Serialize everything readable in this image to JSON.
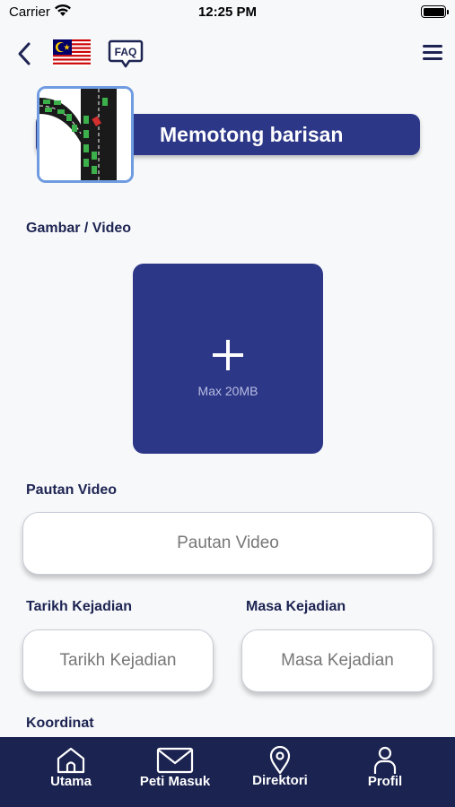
{
  "status_bar": {
    "carrier": "Carrier",
    "time": "12:25 PM"
  },
  "header": {
    "back_icon": "chevron-left-icon",
    "language_flag": "malaysia-flag",
    "faq_label": "FAQ",
    "menu_icon": "hamburger-menu-icon"
  },
  "category": {
    "title": "Memotong barisan"
  },
  "media": {
    "label": "Gambar / Video",
    "upload_hint": "Max 20MB",
    "upload_icon": "plus-icon"
  },
  "video_link": {
    "label": "Pautan Video",
    "placeholder": "Pautan Video"
  },
  "incident_date": {
    "label": "Tarikh Kejadian",
    "placeholder": "Tarikh Kejadian"
  },
  "incident_time": {
    "label": "Masa Kejadian",
    "placeholder": "Masa Kejadian"
  },
  "coordinates": {
    "label": "Koordinat"
  },
  "bottom_nav": {
    "items": [
      {
        "label": "Utama",
        "icon": "home-icon"
      },
      {
        "label": "Peti Masuk",
        "icon": "mail-icon"
      },
      {
        "label": "Direktori",
        "icon": "location-pin-icon"
      },
      {
        "label": "Profil",
        "icon": "user-icon"
      }
    ]
  },
  "colors": {
    "primary": "#2c3788",
    "nav_background": "#1b2350",
    "text_dark": "#1d2452",
    "thumbnail_border": "#6f9ce0"
  }
}
